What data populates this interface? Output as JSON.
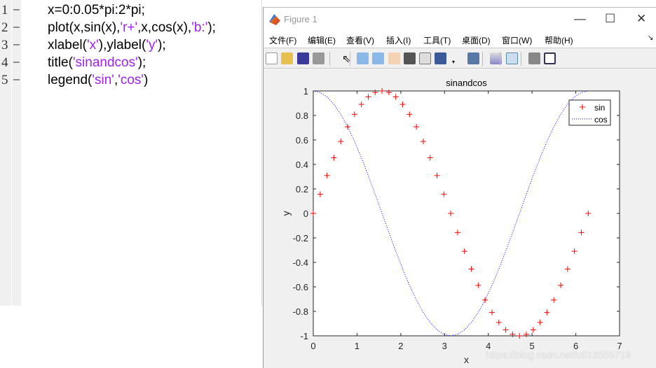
{
  "editor": {
    "lines": [
      {
        "num": "1",
        "dash": "–",
        "segments": [
          {
            "text": "x=0:0.05*pi:2*pi;",
            "type": "code"
          }
        ]
      },
      {
        "num": "2",
        "dash": "–",
        "segments": [
          {
            "text": "plot(x,sin(x),",
            "type": "code"
          },
          {
            "text": "'r+'",
            "type": "str"
          },
          {
            "text": ",x,cos(x),",
            "type": "code"
          },
          {
            "text": "'b:'",
            "type": "str"
          },
          {
            "text": ");",
            "type": "code"
          }
        ]
      },
      {
        "num": "3",
        "dash": "–",
        "segments": [
          {
            "text": "xlabel(",
            "type": "code"
          },
          {
            "text": "'x'",
            "type": "str"
          },
          {
            "text": "),ylabel(",
            "type": "code"
          },
          {
            "text": "'y'",
            "type": "str"
          },
          {
            "text": ");",
            "type": "code"
          }
        ]
      },
      {
        "num": "4",
        "dash": "–",
        "segments": [
          {
            "text": "title(",
            "type": "code"
          },
          {
            "text": "'sinandcos'",
            "type": "str"
          },
          {
            "text": ");",
            "type": "code"
          }
        ]
      },
      {
        "num": "5",
        "dash": "–",
        "segments": [
          {
            "text": "legend(",
            "type": "code"
          },
          {
            "text": "'sin'",
            "type": "str"
          },
          {
            "text": ",",
            "type": "code"
          },
          {
            "text": "'cos'",
            "type": "str"
          },
          {
            "text": ")",
            "type": "code"
          }
        ]
      }
    ],
    "string_color": "#a020f0"
  },
  "figure": {
    "title": "Figure 1",
    "window_buttons": {
      "minimize": "—",
      "maximize": "☐",
      "close": "✕"
    },
    "menu": [
      "文件(F)",
      "编辑(E)",
      "查看(V)",
      "插入(I)",
      "工具(T)",
      "桌面(D)",
      "窗口(W)",
      "帮助(H)"
    ],
    "menu_overflow": "↘",
    "toolbar": [
      "new-file-icon",
      "open-folder-icon",
      "save-icon",
      "print-icon",
      "pointer-icon",
      "zoom-in-icon",
      "zoom-out-icon",
      "pan-hand-icon",
      "rotate-3d-icon",
      "data-cursor-icon",
      "brush-icon",
      "brush-dropdown-icon",
      "link-plot-icon",
      "colorbar-icon",
      "legend-icon",
      "hide-plot-tools-icon",
      "show-plot-tools-icon"
    ]
  },
  "watermark": "https://blog.csdn.net/u013555719",
  "chart_data": {
    "type": "line",
    "title": "sinandcos",
    "xlabel": "x",
    "ylabel": "y",
    "xlim": [
      0,
      7
    ],
    "ylim": [
      -1,
      1
    ],
    "xticks": [
      "0",
      "1",
      "2",
      "3",
      "4",
      "5",
      "6",
      "7"
    ],
    "yticks": [
      "-1",
      "-0.8",
      "-0.6",
      "-0.4",
      "-0.2",
      "0",
      "0.2",
      "0.4",
      "0.6",
      "0.8",
      "1"
    ],
    "grid": false,
    "legend_position": "top-right",
    "x": [
      0,
      0.1571,
      0.3142,
      0.4712,
      0.6283,
      0.7854,
      0.9425,
      1.0996,
      1.2566,
      1.4137,
      1.5708,
      1.7279,
      1.885,
      2.042,
      2.1991,
      2.3562,
      2.5133,
      2.6704,
      2.8274,
      2.9845,
      3.1416,
      3.2987,
      3.4558,
      3.6128,
      3.7699,
      3.927,
      4.0841,
      4.2412,
      4.3982,
      4.5553,
      4.7124,
      4.8695,
      5.0265,
      5.1836,
      5.3407,
      5.4978,
      5.6549,
      5.8119,
      5.969,
      6.1261,
      6.2832
    ],
    "series": [
      {
        "name": "sin",
        "style": "marker-plus",
        "color": "#ff0000",
        "values": [
          0,
          0.1564,
          0.309,
          0.454,
          0.5878,
          0.7071,
          0.809,
          0.891,
          0.9511,
          0.9877,
          1,
          0.9877,
          0.9511,
          0.891,
          0.809,
          0.7071,
          0.5878,
          0.454,
          0.309,
          0.1564,
          0,
          -0.1564,
          -0.309,
          -0.454,
          -0.5878,
          -0.7071,
          -0.809,
          -0.891,
          -0.9511,
          -0.9877,
          -1,
          -0.9877,
          -0.9511,
          -0.891,
          -0.809,
          -0.7071,
          -0.5878,
          -0.454,
          -0.309,
          -0.1564,
          0
        ]
      },
      {
        "name": "cos",
        "style": "dotted",
        "color": "#0000ff",
        "values": [
          1,
          0.9877,
          0.9511,
          0.891,
          0.809,
          0.7071,
          0.5878,
          0.454,
          0.309,
          0.1564,
          0,
          -0.1564,
          -0.309,
          -0.454,
          -0.5878,
          -0.7071,
          -0.809,
          -0.891,
          -0.9511,
          -0.9877,
          -1,
          -0.9877,
          -0.9511,
          -0.891,
          -0.809,
          -0.7071,
          -0.5878,
          -0.454,
          -0.309,
          -0.1564,
          0,
          0.1564,
          0.309,
          0.454,
          0.5878,
          0.7071,
          0.809,
          0.891,
          0.9511,
          0.9877,
          1
        ]
      }
    ]
  }
}
